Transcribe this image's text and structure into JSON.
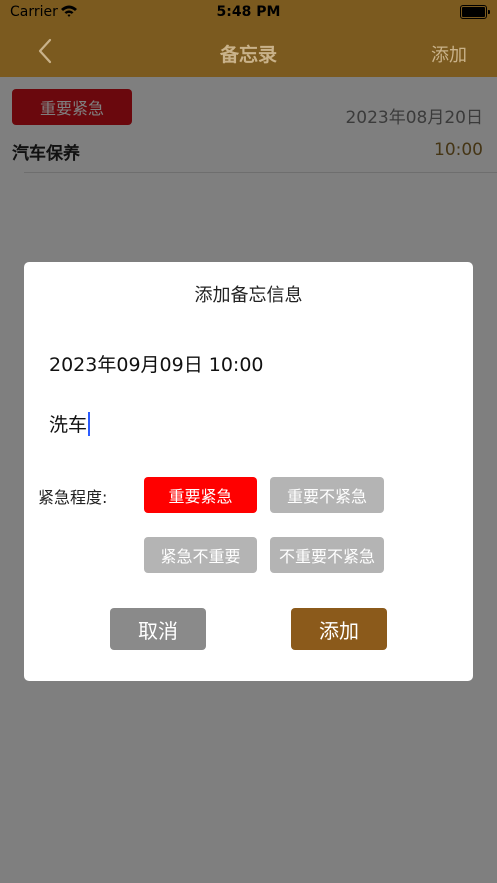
{
  "status_bar": {
    "carrier": "Carrier",
    "time": "5:48 PM",
    "wifi_icon": "wifi-icon",
    "battery_icon": "battery-icon"
  },
  "nav": {
    "back_icon": "chevron-left-icon",
    "title": "备忘录",
    "add_label": "添加"
  },
  "list": {
    "items": [
      {
        "badge": "重要紧急",
        "date": "2023年08月20日",
        "title": "汽车保养",
        "time": "10:00"
      }
    ]
  },
  "dialog": {
    "title": "添加备忘信息",
    "datetime": "2023年09月09日 10:00",
    "input_value": "洗车",
    "urgency_label": "紧急程度:",
    "options": [
      "重要紧急",
      "重要不紧急",
      "紧急不重要",
      "不重要不紧急"
    ],
    "selected_option": "重要紧急",
    "cancel_label": "取消",
    "confirm_label": "添加"
  },
  "colors": {
    "nav_bar": "#7b5a1f",
    "nav_text": "#c9b28a",
    "badge_red": "#d4111a",
    "selected_option": "#ff0000",
    "unselected_option": "#b4b4b4",
    "cancel_button": "#8a8a8a",
    "confirm_button": "#8b5a1b",
    "caret": "#2b5cff"
  }
}
